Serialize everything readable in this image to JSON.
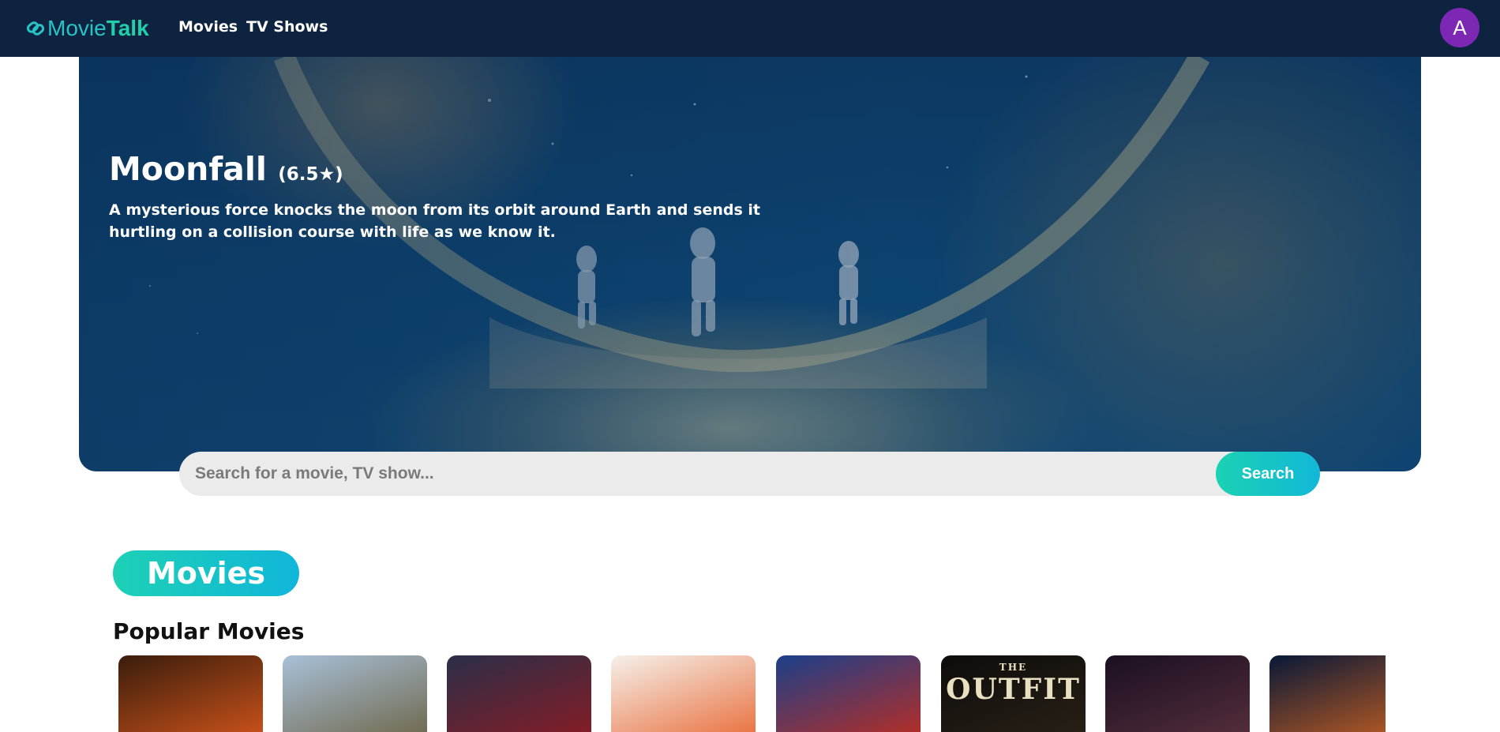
{
  "header": {
    "logo_movie": "Movie",
    "logo_talk": "Talk",
    "nav": [
      {
        "label": "Movies"
      },
      {
        "label": "TV Shows"
      }
    ],
    "avatar_initial": "A",
    "avatar_color": "#7c28b4",
    "background_color": "#0d2340"
  },
  "hero": {
    "title": "Moonfall",
    "rating": "(6.5★)",
    "description": "A mysterious force knocks the moon from its orbit around Earth and sends it hurtling on a collision course with life as we know it."
  },
  "search": {
    "placeholder": "Search for a movie, TV show...",
    "button_label": "Search",
    "accent_gradient": [
      "#1bd1b3",
      "#12b8d8"
    ]
  },
  "section": {
    "label": "Movies",
    "row_title": "Popular Movies"
  },
  "posters": [
    {
      "name": "poster-1",
      "colors": [
        "#3a1d0c",
        "#d8571c"
      ]
    },
    {
      "name": "poster-2",
      "colors": [
        "#a8c0d8",
        "#6a6040"
      ]
    },
    {
      "name": "poster-3",
      "colors": [
        "#2a2e48",
        "#8e1b22"
      ]
    },
    {
      "name": "poster-4",
      "colors": [
        "#f5f0ea",
        "#e8642e"
      ]
    },
    {
      "name": "poster-5",
      "colors": [
        "#1b3f8a",
        "#c52c1c"
      ]
    },
    {
      "name": "poster-6",
      "colors": [
        "#0e0c0a",
        "#2a2218"
      ],
      "text_top": "THE",
      "text": "OUTFIT"
    },
    {
      "name": "poster-7",
      "colors": [
        "#1a1020",
        "#5a3040"
      ]
    },
    {
      "name": "poster-8",
      "colors": [
        "#081838",
        "#d06420"
      ]
    }
  ]
}
